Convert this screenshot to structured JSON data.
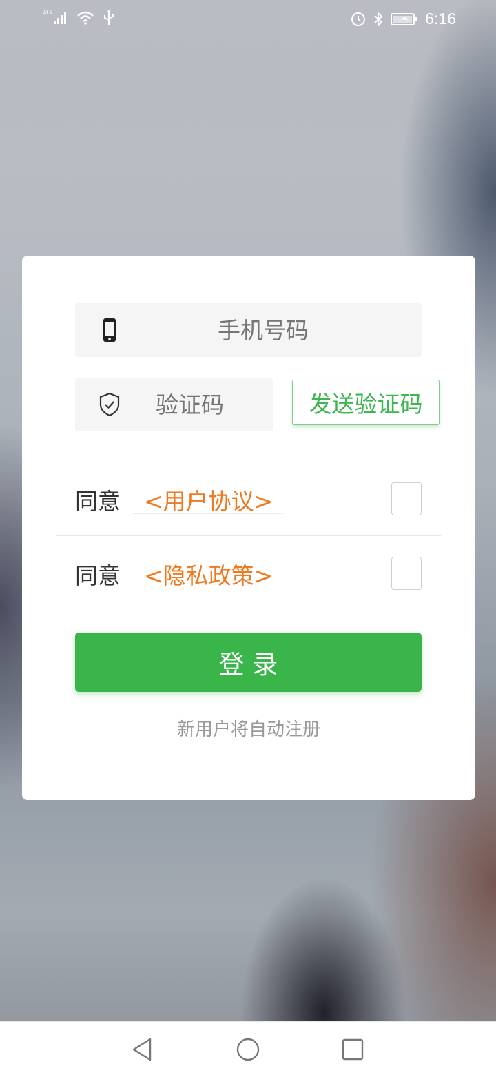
{
  "status_bar": {
    "network_label": "4G",
    "time": "6:16",
    "icons": [
      "signal-icon",
      "wifi-icon",
      "usb-icon",
      "alarm-icon",
      "bluetooth-icon",
      "battery-icon"
    ]
  },
  "login_card": {
    "phone_input": {
      "placeholder": "手机号码",
      "icon": "phone-icon"
    },
    "code_input": {
      "placeholder": "验证码",
      "icon": "shield-check-icon"
    },
    "send_code_label": "发送验证码",
    "agreements": [
      {
        "prefix": "同意",
        "link": "<用户协议>",
        "checked": false
      },
      {
        "prefix": "同意",
        "link": "<隐私政策>",
        "checked": false
      }
    ],
    "login_label": "登录",
    "footer_note": "新用户将自动注册"
  },
  "nav_bar": {
    "buttons": [
      "back-icon",
      "home-icon",
      "recent-apps-icon"
    ]
  },
  "colors": {
    "accent_green": "#39b54a",
    "link_orange": "#ee7a22",
    "input_bg": "#f5f5f5"
  }
}
